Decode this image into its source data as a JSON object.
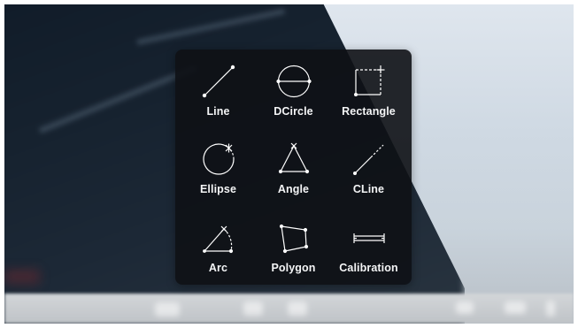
{
  "drawing_tools_menu": {
    "tools": [
      {
        "label": "Line",
        "icon": "line-icon"
      },
      {
        "label": "DCircle",
        "icon": "diameter-circle-icon"
      },
      {
        "label": "Rectangle",
        "icon": "rectangle-icon"
      },
      {
        "label": "Ellipse",
        "icon": "ellipse-icon"
      },
      {
        "label": "Angle",
        "icon": "angle-icon"
      },
      {
        "label": "CLine",
        "icon": "construction-line-icon"
      },
      {
        "label": "Arc",
        "icon": "arc-icon"
      },
      {
        "label": "Polygon",
        "icon": "polygon-icon"
      },
      {
        "label": "Calibration",
        "icon": "calibration-icon"
      }
    ]
  },
  "colors": {
    "panel_background": "#0e1115",
    "icon_stroke": "#ffffff",
    "label_text": "#f4f5f6"
  }
}
